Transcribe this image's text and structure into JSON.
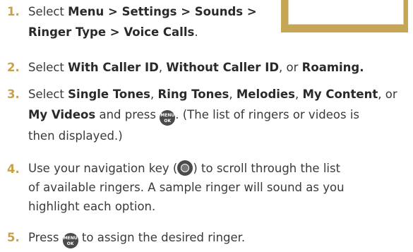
{
  "steps": [
    {
      "num": "1.",
      "line1": [
        "Select ",
        "Menu > Settings > Sounds >"
      ],
      "line2": [
        "Ringer Type > Voice Calls",
        "."
      ]
    },
    {
      "num": "2.",
      "line1": [
        "Select ",
        "With Caller ID",
        ", ",
        "Without Caller ID",
        ", or ",
        "Roaming."
      ]
    },
    {
      "num": "3.",
      "line1": [
        "Select ",
        "Single Tones",
        ", ",
        "Ring Tones",
        ", ",
        "Melodies",
        ", ",
        "My Content",
        ", or"
      ],
      "line2": [
        "My Videos",
        " and press ",
        ". (The list of ringers or videos is"
      ],
      "line3": "then displayed.)"
    },
    {
      "num": "4.",
      "line1": [
        "Use your navigation key (",
        ") to scroll through the list"
      ],
      "line2": "of available ringers. A sample ringer will sound as you",
      "line3": "highlight each option."
    },
    {
      "num": "5.",
      "line1": [
        "Press ",
        " to assign the desired ringer."
      ]
    }
  ],
  "key_menu": {
    "top": "MENU",
    "bottom": "OK"
  }
}
